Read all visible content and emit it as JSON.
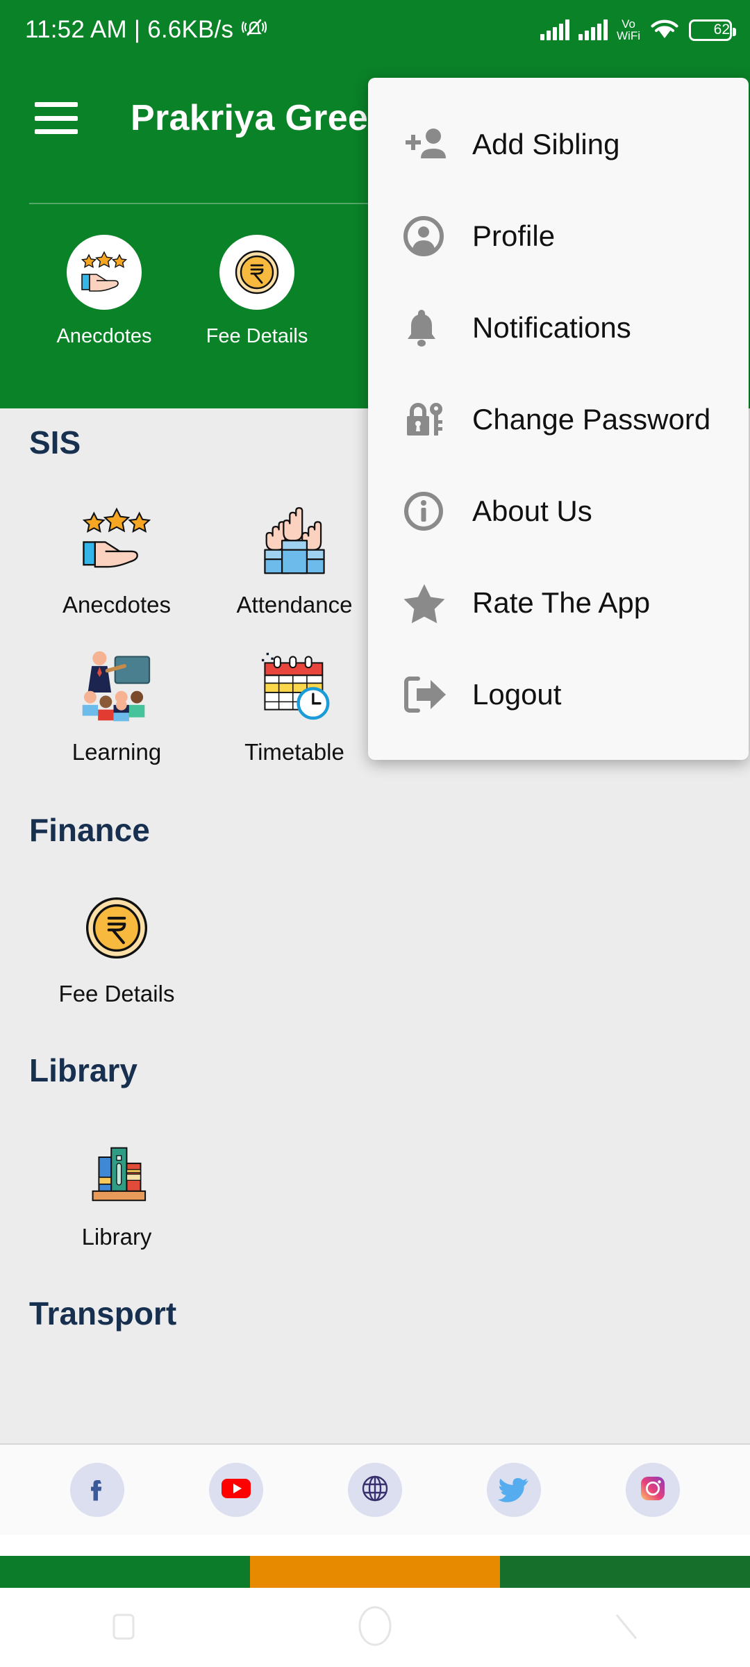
{
  "status_bar": {
    "time": "11:52 AM",
    "separator": "|",
    "network_speed": "6.6KB/s",
    "mute_icon": "vibrate-off-icon",
    "signal_1_icon": "signal-bars-icon",
    "signal_2_icon": "signal-bars-icon",
    "volte_label_top": "Vo",
    "volte_label_bottom": "WiFi",
    "wifi_icon": "wifi-icon",
    "battery_percent": "62"
  },
  "app_bar": {
    "menu_icon": "hamburger-menu-icon",
    "title": "Prakriya Gree"
  },
  "quick_actions": [
    {
      "label": "Anecdotes",
      "icon": "hand-with-stars-icon"
    },
    {
      "label": "Fee Details",
      "icon": "rupee-coin-icon"
    }
  ],
  "sections": [
    {
      "title": "SIS",
      "rows": [
        [
          {
            "label": "Anecdotes",
            "icon": "hand-with-stars-icon"
          },
          {
            "label": "Attendance",
            "icon": "raised-hands-icon"
          }
        ],
        [
          {
            "label": "Learning",
            "icon": "teacher-classroom-icon"
          },
          {
            "label": "Timetable",
            "icon": "calendar-clock-icon"
          }
        ]
      ]
    },
    {
      "title": "Finance",
      "rows": [
        [
          {
            "label": "Fee Details",
            "icon": "rupee-coin-icon"
          }
        ]
      ]
    },
    {
      "title": "Library",
      "rows": [
        [
          {
            "label": "Library",
            "icon": "books-shelf-icon"
          }
        ]
      ]
    },
    {
      "title": "Transport",
      "rows": []
    }
  ],
  "overflow_menu": {
    "items": [
      {
        "label": "Add Sibling",
        "icon": "person-add-icon"
      },
      {
        "label": "Profile",
        "icon": "account-circle-icon"
      },
      {
        "label": "Notifications",
        "icon": "bell-icon"
      },
      {
        "label": "Change Password",
        "icon": "lock-key-icon"
      },
      {
        "label": "About Us",
        "icon": "info-circle-icon"
      },
      {
        "label": "Rate The App",
        "icon": "star-icon"
      },
      {
        "label": "Logout",
        "icon": "logout-arrow-icon"
      }
    ]
  },
  "social_bar": [
    {
      "name": "facebook",
      "icon": "facebook-icon"
    },
    {
      "name": "youtube",
      "icon": "youtube-icon"
    },
    {
      "name": "website",
      "icon": "globe-icon"
    },
    {
      "name": "twitter",
      "icon": "twitter-icon"
    },
    {
      "name": "instagram",
      "icon": "instagram-icon"
    }
  ],
  "bottom_strip": {
    "color_left": "#0C7C2A",
    "color_center": "#E88A00",
    "color_right": "#166F2B"
  },
  "nav_bar": {
    "recents_icon": "square-recents-icon",
    "home_icon": "circle-home-icon",
    "back_icon": "back-icon"
  },
  "colors": {
    "header_green": "#0A8228",
    "body_gray": "#ececec",
    "section_title": "#17304F",
    "menu_bg": "#f8f8f8"
  }
}
